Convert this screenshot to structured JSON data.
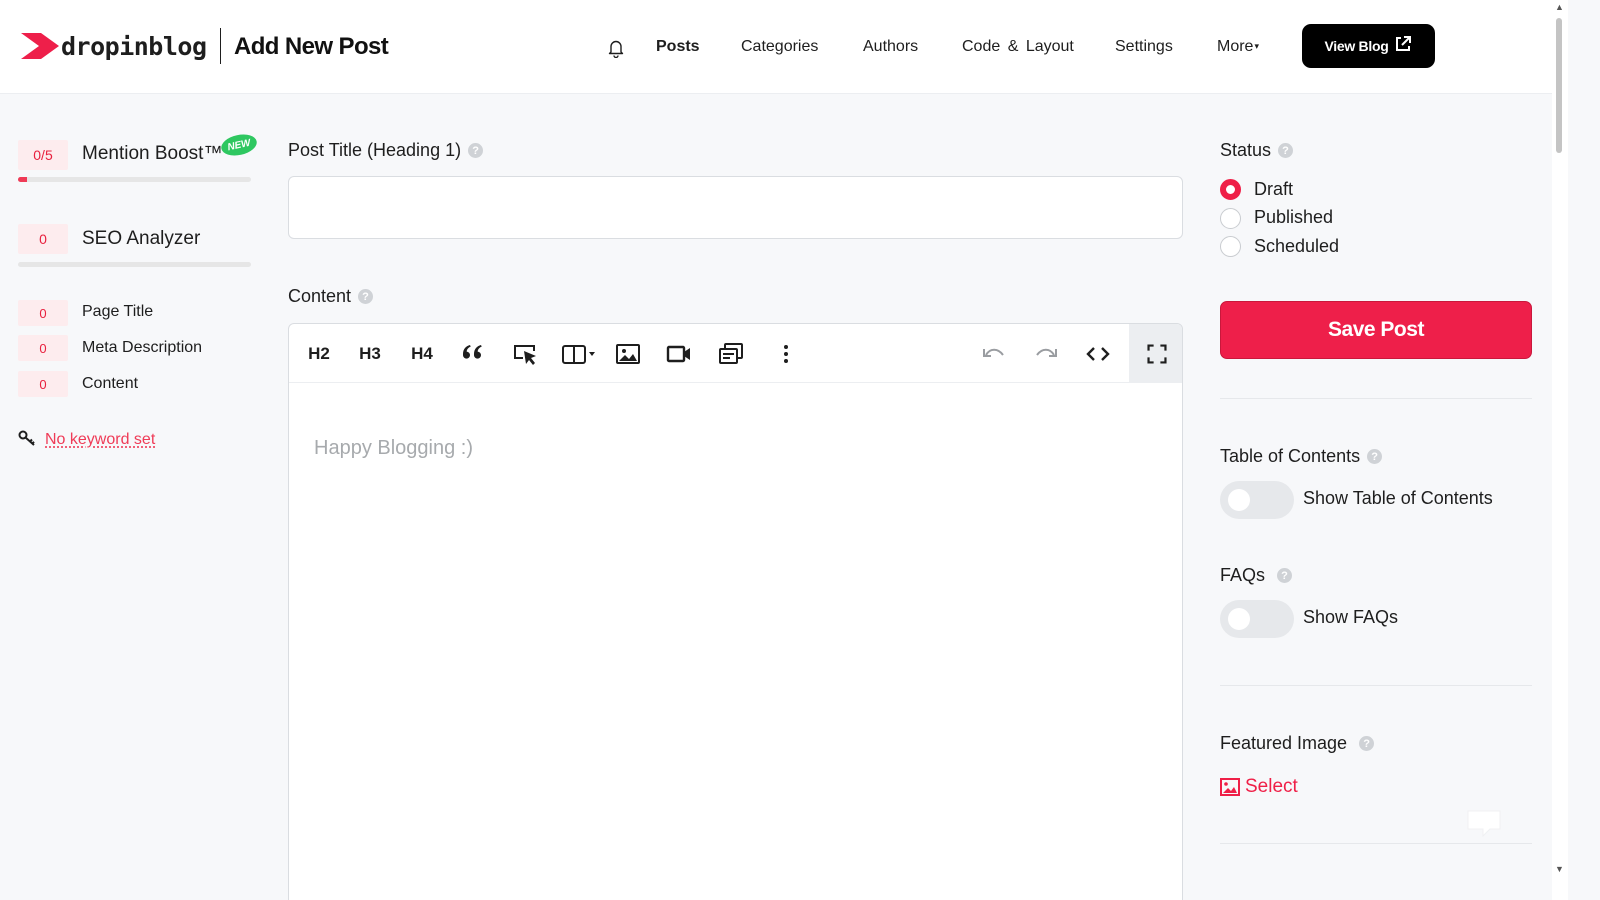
{
  "header": {
    "logo_text": "dropinblog",
    "page_title": "Add New Post",
    "nav": [
      "Posts",
      "Categories",
      "Authors",
      "Code & Layout",
      "Settings",
      "More"
    ],
    "view_blog_label": "View Blog"
  },
  "seo_sidebar": {
    "mention_boost": {
      "score": "0/5",
      "label": "Mention Boost™",
      "badge": "NEW",
      "progress": 0.04
    },
    "seo_analyzer": {
      "score": "0",
      "label": "SEO Analyzer",
      "progress": 0
    },
    "checks": [
      {
        "score": "0",
        "label": "Page Title"
      },
      {
        "score": "0",
        "label": "Meta Description"
      },
      {
        "score": "0",
        "label": "Content"
      }
    ],
    "keyword_link": "No keyword set"
  },
  "editor": {
    "title_label": "Post Title (Heading 1)",
    "title_value": "",
    "content_label": "Content",
    "toolbar": {
      "h2": "H2",
      "h3": "H3",
      "h4": "H4"
    },
    "placeholder": "Happy Blogging :)"
  },
  "right_sidebar": {
    "status_label": "Status",
    "status_options": [
      "Draft",
      "Published",
      "Scheduled"
    ],
    "status_selected": "Draft",
    "save_label": "Save Post",
    "toc_label": "Table of Contents",
    "toc_toggle_label": "Show Table of Contents",
    "toc_enabled": false,
    "faqs_label": "FAQs",
    "faqs_toggle_label": "Show FAQs",
    "faqs_enabled": false,
    "featured_image_label": "Featured Image",
    "select_label": "Select"
  },
  "colors": {
    "accent": "#ee1f4a",
    "badge_green": "#2ec760",
    "score_bg": "#fdecee"
  }
}
